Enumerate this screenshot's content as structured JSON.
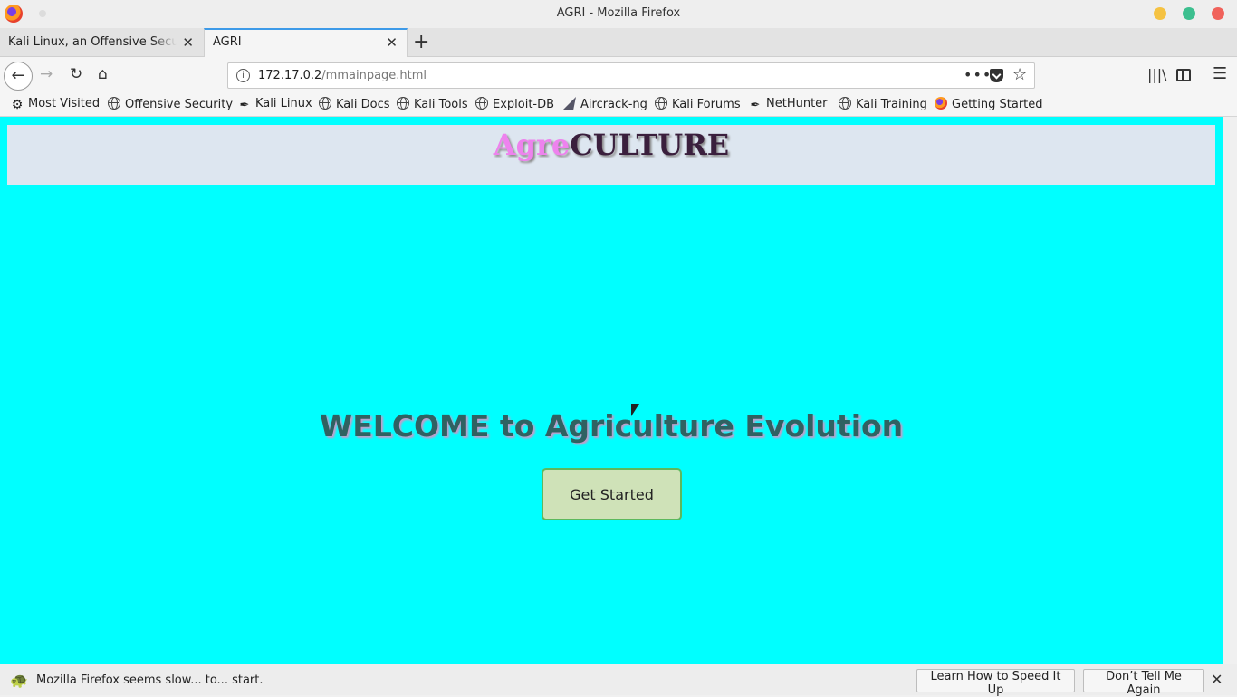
{
  "window": {
    "title": "AGRI - Mozilla Firefox"
  },
  "tabs": [
    {
      "label": "Kali Linux, an Offensive Security"
    },
    {
      "label": "AGRI"
    }
  ],
  "urlbar": {
    "host": "172.17.0.2",
    "path": "/mmainpage.html"
  },
  "bookmarks": [
    {
      "label": "Most Visited",
      "icon": "gear-icon"
    },
    {
      "label": "Offensive Security",
      "icon": "globe-icon"
    },
    {
      "label": "Kali Linux",
      "icon": "kali-dragon-icon"
    },
    {
      "label": "Kali Docs",
      "icon": "globe-icon"
    },
    {
      "label": "Kali Tools",
      "icon": "globe-icon"
    },
    {
      "label": "Exploit-DB",
      "icon": "globe-icon"
    },
    {
      "label": "Aircrack-ng",
      "icon": "aircrack-icon"
    },
    {
      "label": "Kali Forums",
      "icon": "globe-icon"
    },
    {
      "label": "NetHunter",
      "icon": "kali-dragon-icon"
    },
    {
      "label": "Kali Training",
      "icon": "globe-icon"
    },
    {
      "label": "Getting Started",
      "icon": "firefox-icon"
    }
  ],
  "page": {
    "logo_part1": "Agre",
    "logo_part2": "CULTURE",
    "welcome": "WELCOME to Agriculture Evolution",
    "cta_label": "Get Started",
    "background_color": "#00ffff",
    "logo_colors": {
      "agre": "#ee82ee",
      "culture": "#3a1f3d"
    }
  },
  "notification": {
    "message": "Mozilla Firefox seems slow... to... start.",
    "learn_label": "Learn How to Speed It Up",
    "dont_label": "Don’t Tell Me Again"
  }
}
